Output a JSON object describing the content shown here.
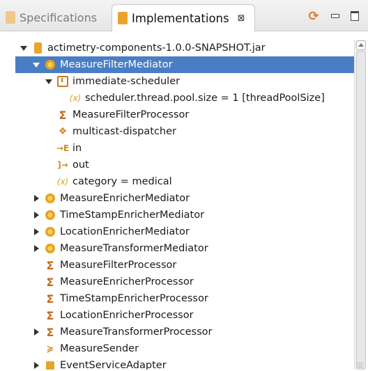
{
  "tabs": [
    {
      "label": "Specifications",
      "active": false
    },
    {
      "label": "Implementations",
      "active": true,
      "close_label": "⊠"
    }
  ],
  "toolbar": {
    "refresh_icon": "refresh-icon",
    "minimize_icon": "minimize-icon",
    "maximize_icon": "maximize-icon"
  },
  "tree": [
    {
      "label": "actimetry-components-1.0.0-SNAPSHOT.jar",
      "icon": "jar-icon",
      "twisty": "open",
      "depth": 0,
      "selected": false
    },
    {
      "label": "MeasureFilterMediator",
      "icon": "component-icon",
      "twisty": "open",
      "depth": 1,
      "selected": true
    },
    {
      "label": "immediate-scheduler",
      "icon": "scheduler-icon",
      "twisty": "open",
      "depth": 2,
      "selected": false
    },
    {
      "label": "scheduler.thread.pool.size = 1 [threadPoolSize]",
      "icon": "variable-icon",
      "twisty": "none",
      "depth": 3,
      "selected": false
    },
    {
      "label": "MeasureFilterProcessor",
      "icon": "sigma-icon",
      "twisty": "none",
      "depth": 2,
      "selected": false
    },
    {
      "label": "multicast-dispatcher",
      "icon": "dispatcher-icon",
      "twisty": "none",
      "depth": 2,
      "selected": false
    },
    {
      "label": "in",
      "icon": "input-port-icon",
      "twisty": "none",
      "depth": 2,
      "selected": false
    },
    {
      "label": "out",
      "icon": "output-port-icon",
      "twisty": "none",
      "depth": 2,
      "selected": false
    },
    {
      "label": "category = medical",
      "icon": "variable-icon",
      "twisty": "none",
      "depth": 2,
      "selected": false
    },
    {
      "label": "MeasureEnricherMediator",
      "icon": "component-icon",
      "twisty": "closed",
      "depth": 1,
      "selected": false
    },
    {
      "label": "TimeStampEnricherMediator",
      "icon": "component-icon",
      "twisty": "closed",
      "depth": 1,
      "selected": false
    },
    {
      "label": "LocationEnricherMediator",
      "icon": "component-icon",
      "twisty": "closed",
      "depth": 1,
      "selected": false
    },
    {
      "label": "MeasureTransformerMediator",
      "icon": "component-icon",
      "twisty": "closed",
      "depth": 1,
      "selected": false
    },
    {
      "label": "MeasureFilterProcessor",
      "icon": "sigma-icon",
      "twisty": "none",
      "depth": 1,
      "selected": false
    },
    {
      "label": "MeasureEnricherProcessor",
      "icon": "sigma-icon",
      "twisty": "none",
      "depth": 1,
      "selected": false
    },
    {
      "label": "TimeStampEnricherProcessor",
      "icon": "sigma-icon",
      "twisty": "none",
      "depth": 1,
      "selected": false
    },
    {
      "label": "LocationEnricherProcessor",
      "icon": "sigma-icon",
      "twisty": "none",
      "depth": 1,
      "selected": false
    },
    {
      "label": "MeasureTransformerProcessor",
      "icon": "sigma-icon",
      "twisty": "closed",
      "depth": 1,
      "selected": false
    },
    {
      "label": "MeasureSender",
      "icon": "sender-icon",
      "twisty": "none",
      "depth": 1,
      "selected": false
    },
    {
      "label": "EventServiceAdapter",
      "icon": "adapter-icon",
      "twisty": "closed",
      "depth": 1,
      "selected": false
    }
  ],
  "colors": {
    "selection": "#4a7ec4",
    "accent": "#e9a42b"
  }
}
